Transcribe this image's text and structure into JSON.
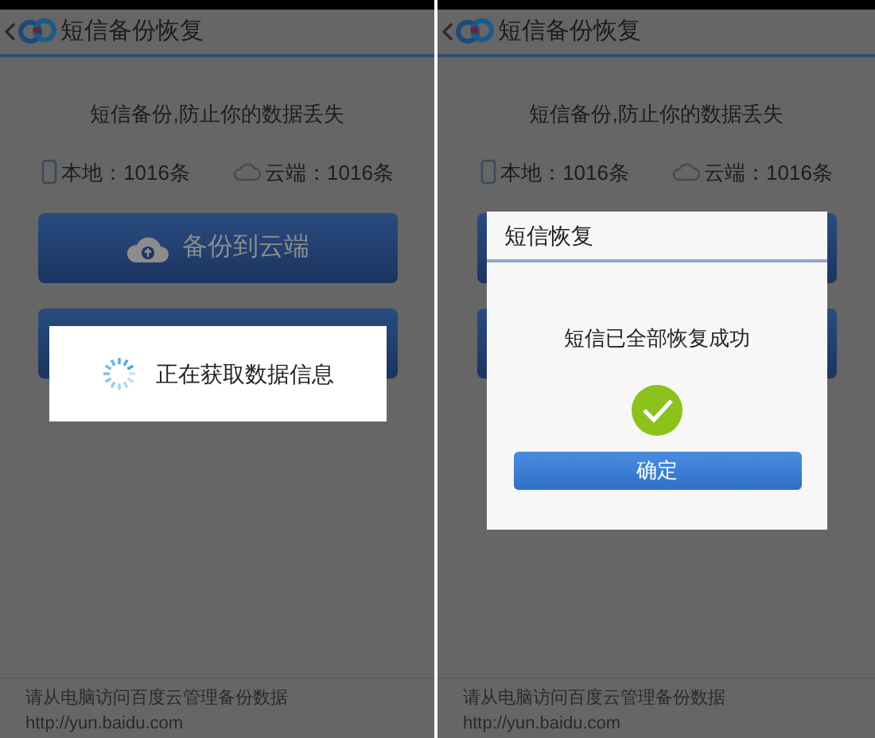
{
  "screens": [
    {
      "title": "短信备份恢复",
      "subtitle": "短信备份,防止你的数据丢失",
      "local_count": "本地：1016条",
      "cloud_count": "云端：1016条",
      "buttons": [
        {
          "kind": "upload",
          "label": "备份到云端"
        },
        {
          "kind": "blank"
        }
      ],
      "dialog": {
        "kind": "loading",
        "message": "正在获取数据信息"
      },
      "footer": {
        "hint": "请从电脑访问百度云管理备份数据",
        "url": "http://yun.baidu.com"
      }
    },
    {
      "title": "短信备份恢复",
      "subtitle": "短信备份,防止你的数据丢失",
      "local_count": "本地：1016条",
      "cloud_count": "云端：1016条",
      "buttons": [
        {
          "kind": "blank"
        },
        {
          "kind": "blank"
        }
      ],
      "dialog": {
        "kind": "result",
        "title": "短信恢复",
        "message": "短信已全部恢复成功",
        "ok_label": "确定"
      },
      "footer": {
        "hint": "请从电脑访问百度云管理备份数据",
        "url": "http://yun.baidu.com"
      }
    }
  ]
}
